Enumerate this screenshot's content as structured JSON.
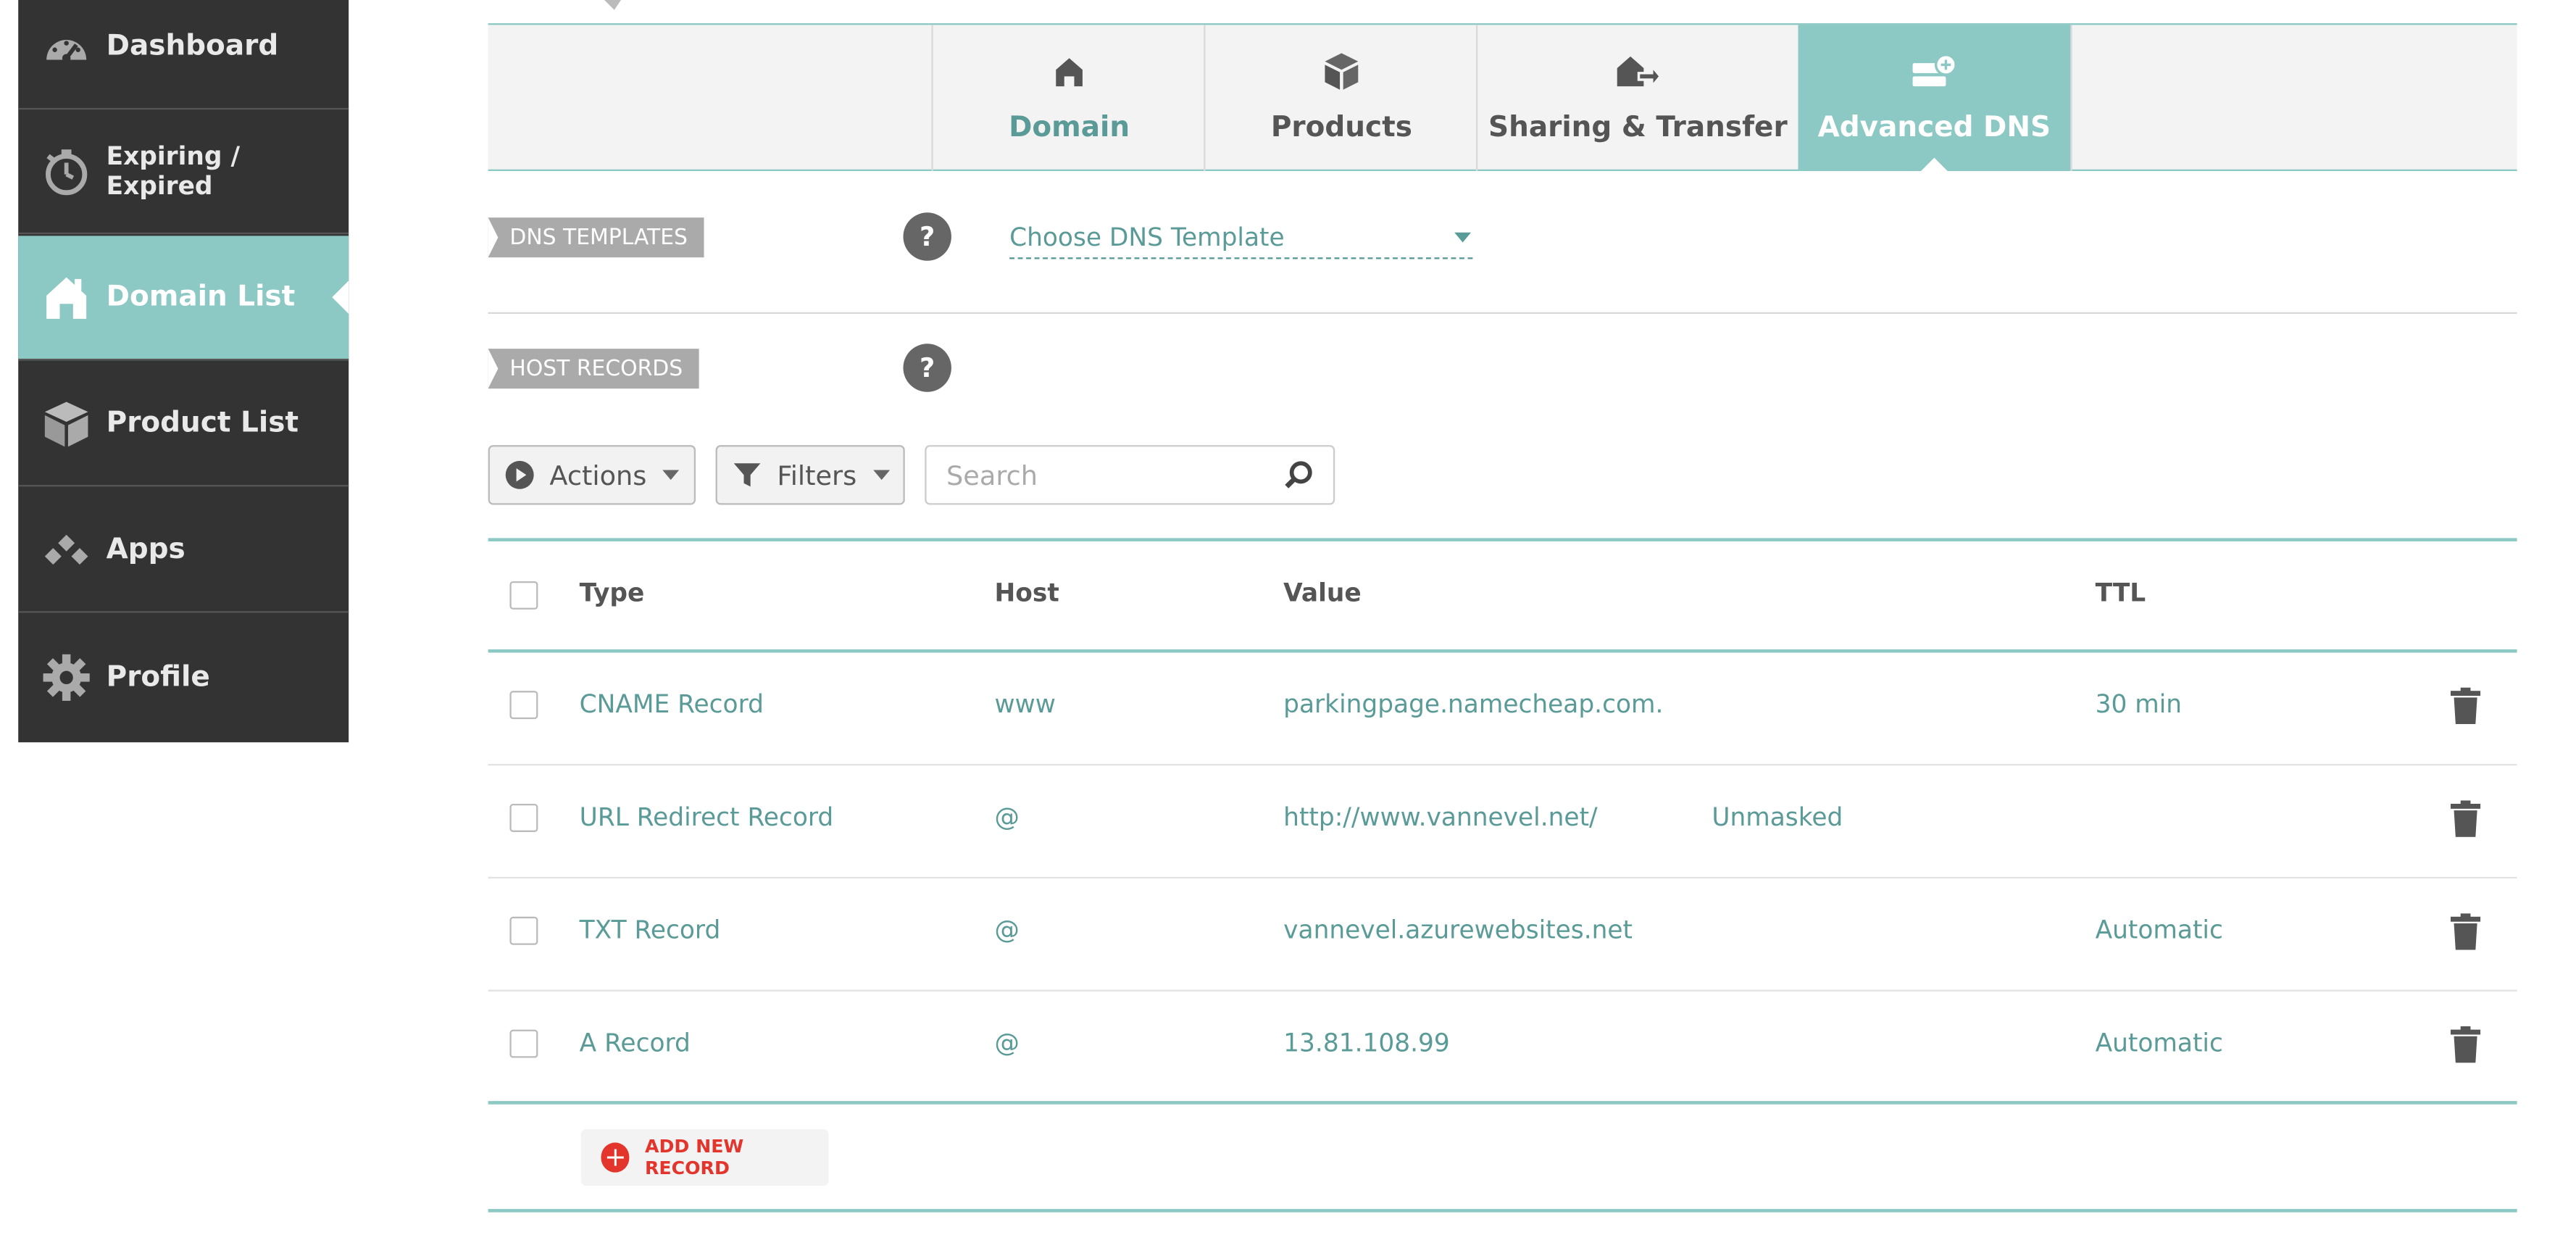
{
  "sidebar": {
    "items": [
      {
        "label": "Dashboard",
        "icon": "gauge-icon"
      },
      {
        "label": "Expiring / Expired",
        "icon": "stopwatch-icon"
      },
      {
        "label": "Domain List",
        "icon": "home-icon",
        "active": true
      },
      {
        "label": "Product List",
        "icon": "box-icon"
      },
      {
        "label": "Apps",
        "icon": "apps-icon"
      },
      {
        "label": "Profile",
        "icon": "gear-icon"
      }
    ]
  },
  "tabs": [
    {
      "label": "Domain",
      "icon": "home-icon"
    },
    {
      "label": "Products",
      "icon": "box-icon"
    },
    {
      "label": "Sharing & Transfer",
      "icon": "transfer-icon"
    },
    {
      "label": "Advanced DNS",
      "icon": "server-icon",
      "active": true
    }
  ],
  "dns_templates": {
    "label": "DNS TEMPLATES",
    "help": "?",
    "select_value": "Choose DNS Template"
  },
  "host_records": {
    "label": "HOST RECORDS",
    "help": "?"
  },
  "toolbar": {
    "actions": "Actions",
    "filters": "Filters",
    "search_placeholder": "Search"
  },
  "table": {
    "headers": {
      "type": "Type",
      "host": "Host",
      "value": "Value",
      "ttl": "TTL"
    },
    "rows": [
      {
        "type": "CNAME Record",
        "host": "www",
        "value": "parkingpage.namecheap.com.",
        "extra": "",
        "ttl": "30 min"
      },
      {
        "type": "URL Redirect Record",
        "host": "@",
        "value": "http://www.vannevel.net/",
        "extra": "Unmasked",
        "ttl": ""
      },
      {
        "type": "TXT Record",
        "host": "@",
        "value": "vannevel.azurewebsites.net",
        "extra": "",
        "ttl": "Automatic"
      },
      {
        "type": "A Record",
        "host": "@",
        "value": "13.81.108.99",
        "extra": "",
        "ttl": "Automatic"
      }
    ]
  },
  "add_record": {
    "label": "ADD NEW RECORD"
  },
  "colors": {
    "teal": "#8cc8c4",
    "text_teal": "#5a9b98",
    "sidebar_bg": "#333333",
    "red": "#e3352b"
  }
}
